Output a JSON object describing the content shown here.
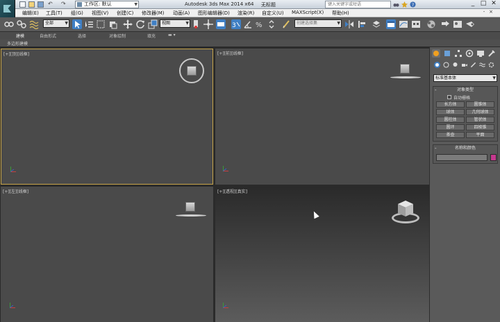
{
  "titlebar": {
    "workspace_label": "工作区: 默认",
    "app_title": "Autodesk 3ds Max  2014 x64",
    "document_title": "无标题",
    "search_placeholder": "键入关键字或短语"
  },
  "menubar": {
    "items": [
      "编辑(E)",
      "工具(T)",
      "组(G)",
      "视图(V)",
      "创建(C)",
      "修改器(M)",
      "动画(A)",
      "图形编辑器(D)",
      "渲染(R)",
      "自定义(U)",
      "MAXScript(X)",
      "帮助(H)"
    ]
  },
  "toolbar": {
    "selection_filter": "全部",
    "reference_coord": "视图",
    "named_selection": "创建选择集"
  },
  "ribbon": {
    "tabs": [
      "建模",
      "自由形式",
      "选择",
      "对象绘制",
      "填充"
    ],
    "panel_label": "多边形建模"
  },
  "viewports": {
    "top_label": "[+][顶][线框]",
    "front_label": "[+][前][线框]",
    "left_label": "[+][左][线框]",
    "persp_label": "[+][透视][真实]"
  },
  "command_panel": {
    "category_dropdown": "标准基本体",
    "object_type_title": "对象类型",
    "autogrid_label": "自动栅格",
    "object_buttons": [
      "长方体",
      "圆锥体",
      "球体",
      "几何球体",
      "圆柱体",
      "管状体",
      "圆环",
      "四棱锥",
      "茶壶",
      "平面"
    ],
    "name_color_title": "名称和颜色",
    "object_color": "#c5398f"
  }
}
